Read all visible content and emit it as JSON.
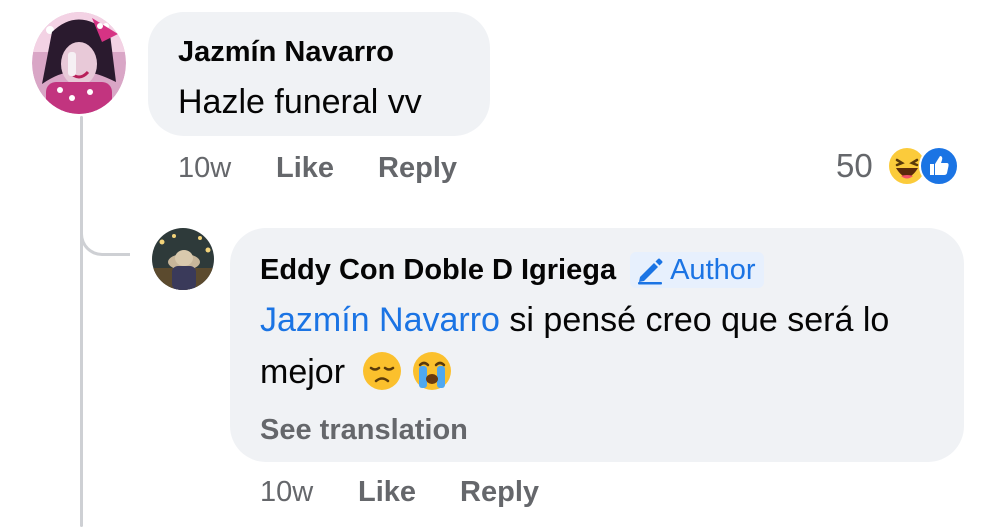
{
  "comment": {
    "author": "Jazmín Navarro",
    "text": "Hazle funeral vv",
    "time": "10w",
    "like_label": "Like",
    "reply_label": "Reply",
    "reaction_count": "50",
    "reaction_icons": [
      "haha-reaction-icon",
      "like-reaction-icon"
    ]
  },
  "reply": {
    "author": "Eddy Con Doble D Igriega",
    "badge_label": "Author",
    "mention": "Jazmín Navarro",
    "text": " si pensé creo que será lo mejor",
    "emojis": [
      "disappointed-face-icon",
      "crying-face-icon"
    ],
    "see_translation": "See translation",
    "time": "10w",
    "like_label": "Like",
    "reply_label": "Reply"
  },
  "colors": {
    "bubble": "#f0f2f5",
    "link_blue": "#1b74e4",
    "secondary_text": "#65676b",
    "thread_line": "#ced0d4"
  }
}
